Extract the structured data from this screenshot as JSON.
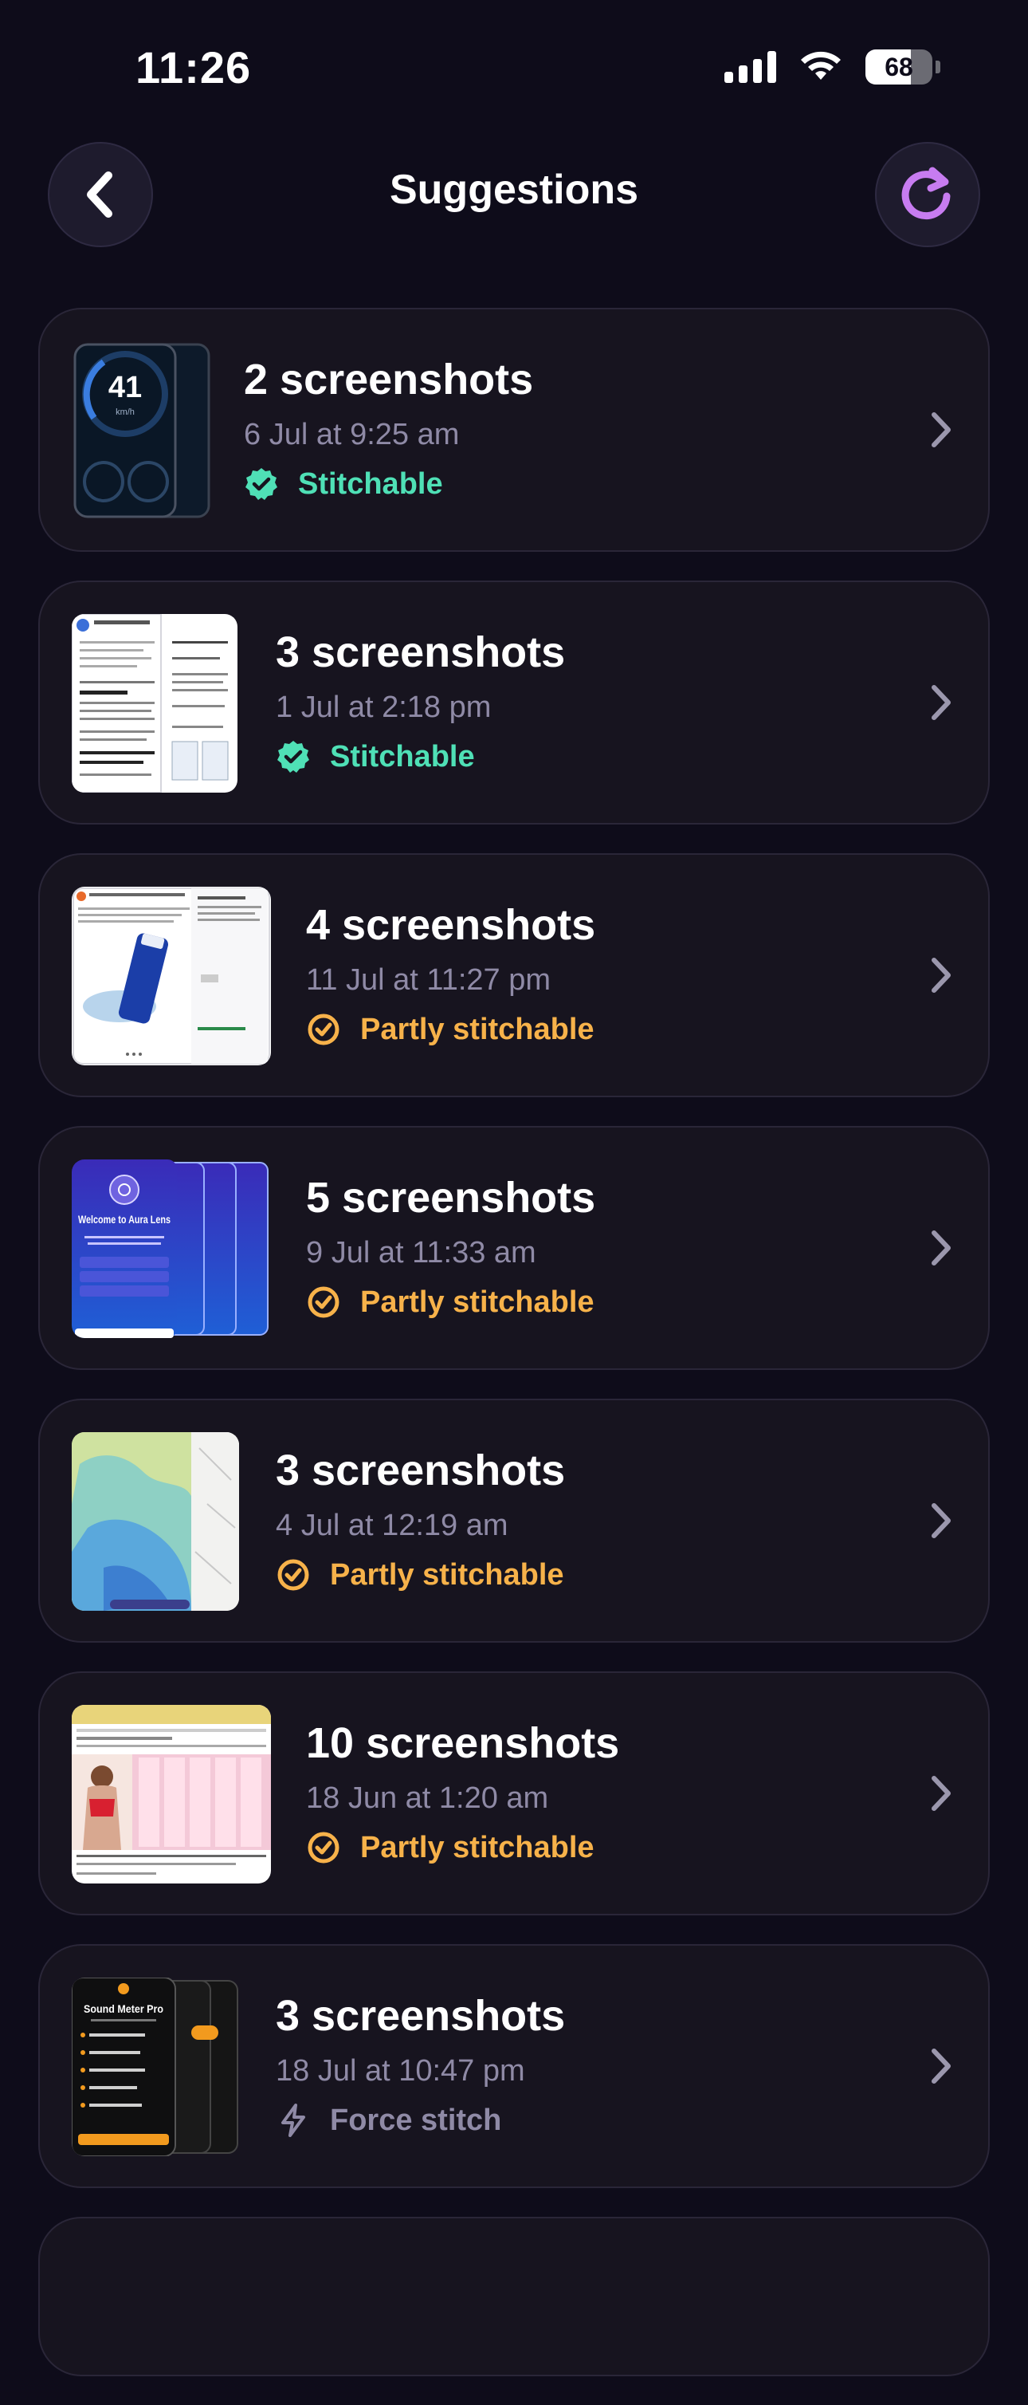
{
  "status_bar": {
    "time": "11:26",
    "battery": "68",
    "battery_level": 0.68,
    "icons": [
      "cellular-signal-icon",
      "wifi-icon",
      "battery-icon"
    ]
  },
  "header": {
    "title": "Suggestions",
    "back_icon": "chevron-left-icon",
    "refresh_icon": "refresh-icon",
    "accent_color": "#c77cf0"
  },
  "colors": {
    "stitchable": "#4fe0b6",
    "partly": "#f7b24a",
    "force": "#8f8aa6",
    "card_bg": "#17141f",
    "page_bg": "#0e0c1a"
  },
  "suggestions": [
    {
      "count_label": "2 screenshots",
      "date": "6 Jul at 9:25 am",
      "status": "Stitchable",
      "status_type": "stitchable",
      "thumb": "speedometer-screenshots"
    },
    {
      "count_label": "3 screenshots",
      "date": "1 Jul at 2:18 pm",
      "status": "Stitchable",
      "status_type": "stitchable",
      "thumb": "email-screenshots"
    },
    {
      "count_label": "4 screenshots",
      "date": "11 Jul at 11:27 pm",
      "status": "Partly stitchable",
      "status_type": "partly",
      "thumb": "skincare-product-screenshots"
    },
    {
      "count_label": "5 screenshots",
      "date": "9 Jul at 11:33 am",
      "status": "Partly stitchable",
      "status_type": "partly",
      "thumb": "aura-lens-onboarding-screenshots"
    },
    {
      "count_label": "3 screenshots",
      "date": "4 Jul at 12:19 am",
      "status": "Partly stitchable",
      "status_type": "partly",
      "thumb": "weather-map-screenshots"
    },
    {
      "count_label": "10 screenshots",
      "date": "18 Jun at 1:20 am",
      "status": "Partly stitchable",
      "status_type": "partly",
      "thumb": "shopping-feed-screenshots"
    },
    {
      "count_label": "3 screenshots",
      "date": "18 Jul at 10:47 pm",
      "status": "Force stitch",
      "status_type": "force",
      "thumb": "sound-meter-pro-screenshots"
    }
  ],
  "thumb_text": {
    "speed": "41",
    "speed_unit": "km/h",
    "aura_title": "Welcome to Aura Lens",
    "sound_title": "Sound Meter Pro"
  }
}
